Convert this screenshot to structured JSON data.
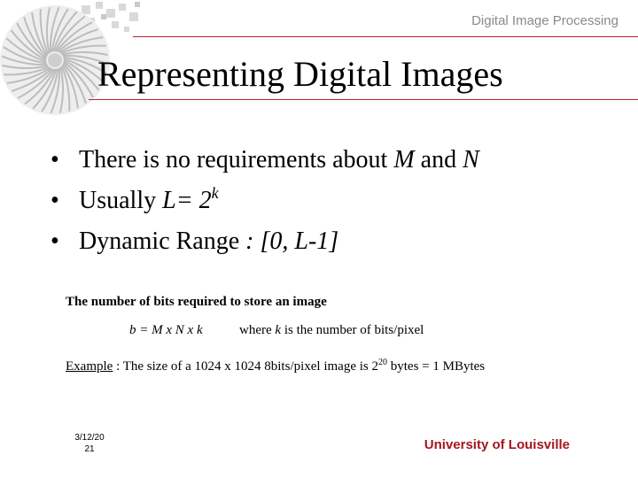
{
  "header": {
    "course_title": "Digital Image Processing"
  },
  "slide": {
    "title": "Representing Digital Images",
    "bullets": [
      {
        "pre": "There is no requirements about ",
        "m": "M",
        "and": " and ",
        "n": "N"
      },
      {
        "pre": "Usually ",
        "l": "L",
        "eq": "= 2",
        "exp": "k"
      },
      {
        "pre": "Dynamic Range ",
        "range": ": [0, L-1]"
      }
    ],
    "bits": {
      "heading": "The number of bits required to store an image",
      "formula": "b = M x N x k",
      "where_pre": "where ",
      "where_k": "k",
      "where_post": " is the number of bits/pixel",
      "example_label": "Example",
      "example_pre": " : The size of a  1024 x 1024 8bits/pixel image is  2",
      "example_exp": "20",
      "example_post": " bytes = 1 MBytes"
    }
  },
  "footer": {
    "date": "3/12/20",
    "page": "21",
    "institution": "University of Louisville"
  },
  "colors": {
    "accent": "#c0202a",
    "institution": "#a4161e",
    "header_text": "#8a8a8a"
  }
}
